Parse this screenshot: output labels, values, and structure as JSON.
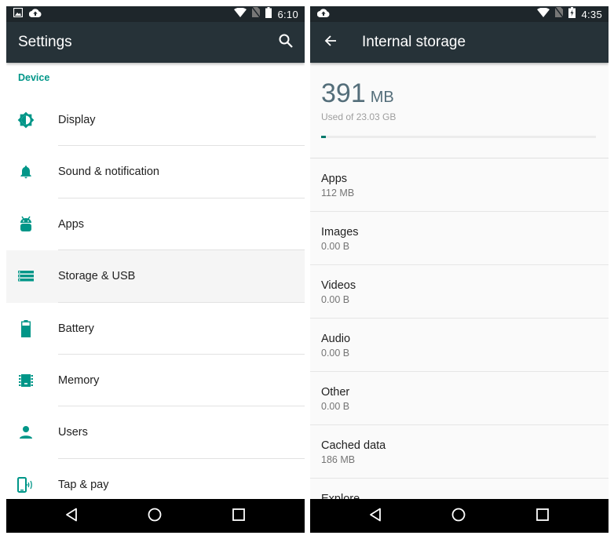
{
  "colors": {
    "accent": "#009688",
    "appbar": "#263238",
    "statusbar": "#1e262b",
    "navbar": "#000000",
    "progress": "#00796b"
  },
  "left_screen": {
    "statusbar": {
      "left_icons": [
        "image-notification-icon",
        "cloud-upload-icon"
      ],
      "right_icons": [
        "wifi-icon",
        "no-sim-icon",
        "battery-icon"
      ],
      "time": "6:10"
    },
    "appbar": {
      "title": "Settings",
      "action_icon": "search-icon"
    },
    "section_header": "Device",
    "items": [
      {
        "label": "Display",
        "icon": "brightness-icon",
        "selected": false
      },
      {
        "label": "Sound & notification",
        "icon": "bell-icon",
        "selected": false
      },
      {
        "label": "Apps",
        "icon": "android-icon",
        "selected": false
      },
      {
        "label": "Storage & USB",
        "icon": "storage-icon",
        "selected": true
      },
      {
        "label": "Battery",
        "icon": "battery-icon",
        "selected": false
      },
      {
        "label": "Memory",
        "icon": "memory-chip-icon",
        "selected": false
      },
      {
        "label": "Users",
        "icon": "person-icon",
        "selected": false
      },
      {
        "label": "Tap & pay",
        "icon": "nfc-phone-icon",
        "selected": false
      }
    ],
    "navbar": [
      "back-icon",
      "home-icon",
      "recents-icon"
    ]
  },
  "right_screen": {
    "statusbar": {
      "left_icons": [
        "cloud-upload-icon"
      ],
      "right_icons": [
        "wifi-icon",
        "no-sim-icon",
        "battery-charging-icon"
      ],
      "time": "4:35"
    },
    "appbar": {
      "title": "Internal storage",
      "nav_icon": "arrow-back-icon"
    },
    "summary": {
      "used_value": "391",
      "used_unit": "MB",
      "total_text": "Used of 23.03 GB",
      "used_fraction": 0.0166
    },
    "items": [
      {
        "title": "Apps",
        "value": "112 MB"
      },
      {
        "title": "Images",
        "value": "0.00 B"
      },
      {
        "title": "Videos",
        "value": "0.00 B"
      },
      {
        "title": "Audio",
        "value": "0.00 B"
      },
      {
        "title": "Other",
        "value": "0.00 B"
      },
      {
        "title": "Cached data",
        "value": "186 MB"
      },
      {
        "title": "Explore",
        "value": ""
      }
    ],
    "navbar": [
      "back-icon",
      "home-icon",
      "recents-icon"
    ]
  }
}
